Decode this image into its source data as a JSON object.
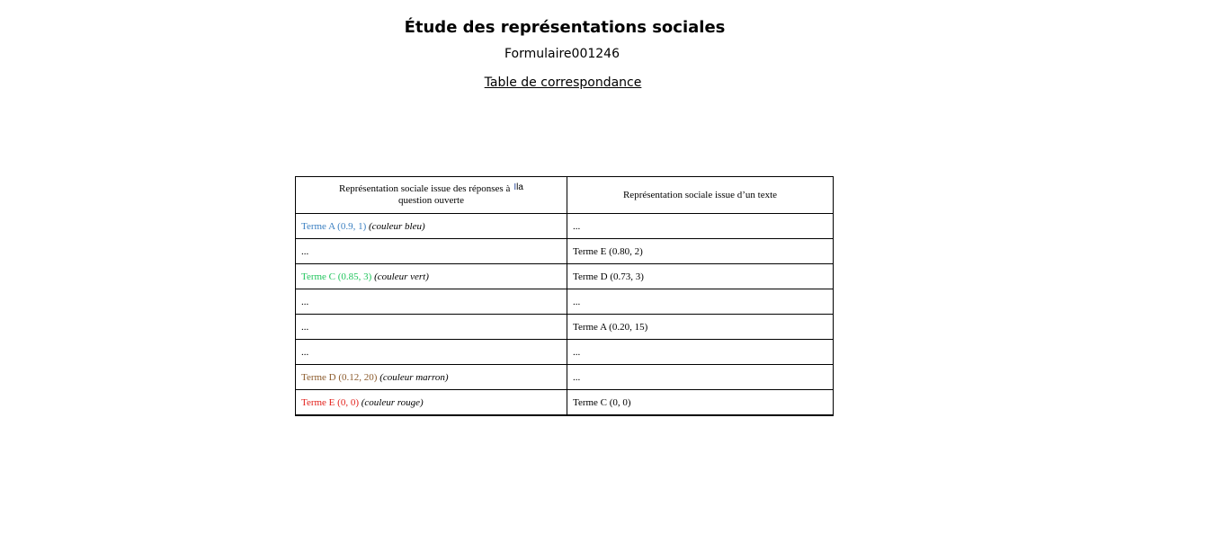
{
  "header": {
    "title": "Étude des représentations sociales",
    "form_id": "Formulaire001246",
    "table_link": "Table de correspondance"
  },
  "colors": {
    "blue": "#3a7fc1",
    "green": "#22c55e",
    "brown": "#8b5a2b",
    "red": "#e3201b",
    "black": "#000000"
  },
  "table": {
    "headers": {
      "left_line1": "Représentation sociale issue des réponses à",
      "left_mark": "la",
      "left_line2": "question ouverte",
      "right": "Représentation sociale issue d’un texte"
    },
    "rows": [
      {
        "left_term": "Terme A (0.9, 1)",
        "left_note": "(couleur bleu)",
        "left_color": "blue",
        "right": "..."
      },
      {
        "left_term": "...",
        "left_note": "",
        "left_color": "black",
        "right": "Terme E (0.80, 2)"
      },
      {
        "left_term": "Terme C (0.85, 3)",
        "left_note": "(couleur vert)",
        "left_color": "green",
        "right": "Terme D (0.73, 3)"
      },
      {
        "left_term": "...",
        "left_note": "",
        "left_color": "black",
        "right": "..."
      },
      {
        "left_term": "...",
        "left_note": "",
        "left_color": "black",
        "right": "Terme A (0.20, 15)"
      },
      {
        "left_term": "...",
        "left_note": "",
        "left_color": "black",
        "right": "..."
      },
      {
        "left_term": "Terme D (0.12, 20)",
        "left_note": "(couleur marron)",
        "left_color": "brown",
        "right": "..."
      },
      {
        "left_term": "Terme E (0, 0)",
        "left_note": "(couleur rouge)",
        "left_color": "red",
        "right": "Terme C (0, 0)"
      }
    ]
  }
}
